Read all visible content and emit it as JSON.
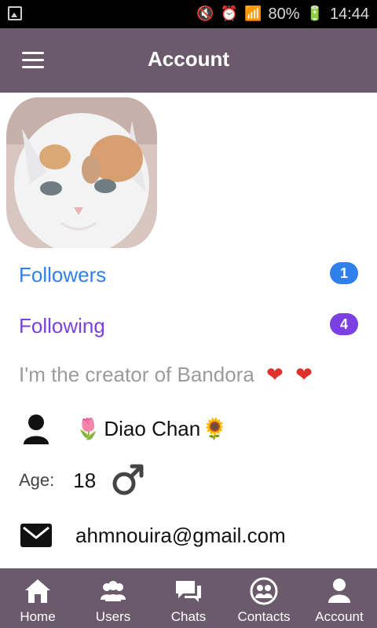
{
  "status": {
    "battery": "80%",
    "time": "14:44"
  },
  "header": {
    "title": "Account"
  },
  "profile": {
    "followers": {
      "label": "Followers",
      "count": "1"
    },
    "following": {
      "label": "Following",
      "count": "4"
    },
    "bio": "I'm the creator of Bandora",
    "name": "Diao Chan",
    "age_label": "Age:",
    "age": "18",
    "email": "ahmnouira@gmail.com"
  },
  "nav": [
    {
      "label": "Home",
      "icon": "home-icon"
    },
    {
      "label": "Users",
      "icon": "users-icon"
    },
    {
      "label": "Chats",
      "icon": "chats-icon"
    },
    {
      "label": "Contacts",
      "icon": "contacts-icon"
    },
    {
      "label": "Account",
      "icon": "account-icon"
    }
  ],
  "colors": {
    "appbar": "#6b5a6b",
    "followers": "#2f80ed",
    "following": "#7b3fe4"
  }
}
